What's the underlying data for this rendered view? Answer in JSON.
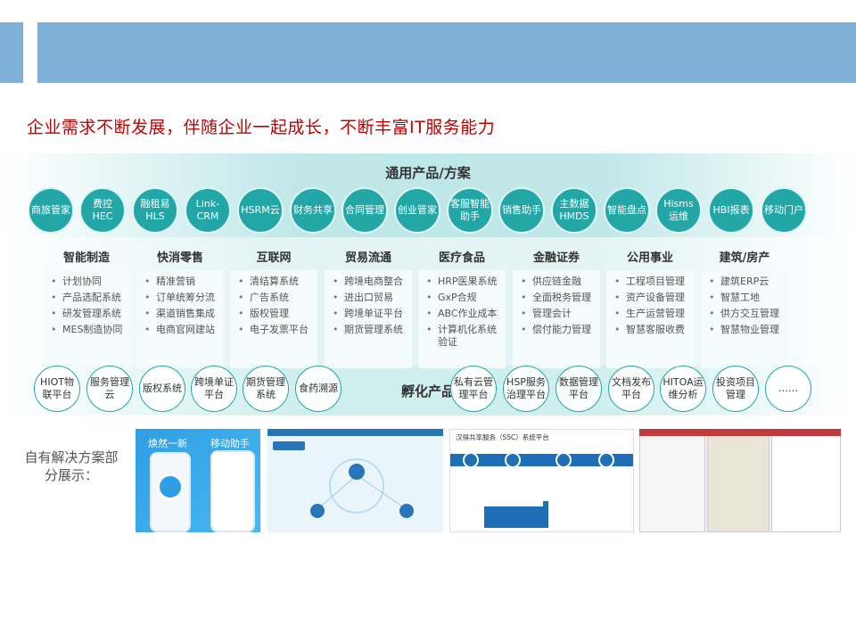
{
  "subtitle": "企业需求不断发展，伴随企业一起成长，不断丰富IT服务能力",
  "general": {
    "title": "通用产品/方案",
    "items": [
      "商旅管家",
      "费控HEC",
      "融租易HLS",
      "Link-CRM",
      "HSRM云",
      "财务共享",
      "合同管理",
      "创业管家",
      "客服智能助手",
      "销售助手",
      "主数据HMDS",
      "智能盘点",
      "Hisms运维",
      "HBI报表",
      "移动门户"
    ]
  },
  "sectors": [
    {
      "title": "智能制造",
      "items": [
        "计划协同",
        "产品选配系统",
        "研发管理系统",
        "MES制造协同"
      ]
    },
    {
      "title": "快消零售",
      "items": [
        "精准营销",
        "订单统筹分流",
        "渠道销售集成",
        "电商官网建站"
      ]
    },
    {
      "title": "互联网",
      "items": [
        "清结算系统",
        "广告系统",
        "版权管理",
        "电子发票平台"
      ]
    },
    {
      "title": "贸易流通",
      "items": [
        "跨境电商整合",
        "进出口贸易",
        "跨境单证平台",
        "期货管理系统"
      ]
    },
    {
      "title": "医疗食品",
      "items": [
        "HRP医果系统",
        "GxP合规",
        "ABC作业成本",
        "计算机化系统验证"
      ]
    },
    {
      "title": "金融证券",
      "items": [
        "供应链金融",
        "全面税务管理",
        "管理会计",
        "偿付能力管理"
      ]
    },
    {
      "title": "公用事业",
      "items": [
        "工程项目管理",
        "资产设备管理",
        "生产运营管理",
        "智慧客服收费"
      ]
    },
    {
      "title": "建筑/房产",
      "items": [
        "建筑ERP云",
        "智慧工地",
        "供方交互管理",
        "智慧物业管理"
      ]
    }
  ],
  "incubation": {
    "title": "孵化产品",
    "items": [
      "HIOT物联平台",
      "服务管理云",
      "版权系统",
      "跨境单证平台",
      "期货管理系统",
      "食药溯源",
      "私有云管理平台",
      "HSP服务治理平台",
      "数据管理平台",
      "文档发布平台",
      "HITOA运维分析",
      "投资项目管理",
      "……"
    ]
  },
  "showcase": {
    "label": "自有解决方案部分展示：",
    "shot1": {
      "text_a": "焕然一新",
      "text_b": "移动助手"
    },
    "shot3": {
      "title": "汉得共享服务（SSC）系统平台"
    }
  }
}
